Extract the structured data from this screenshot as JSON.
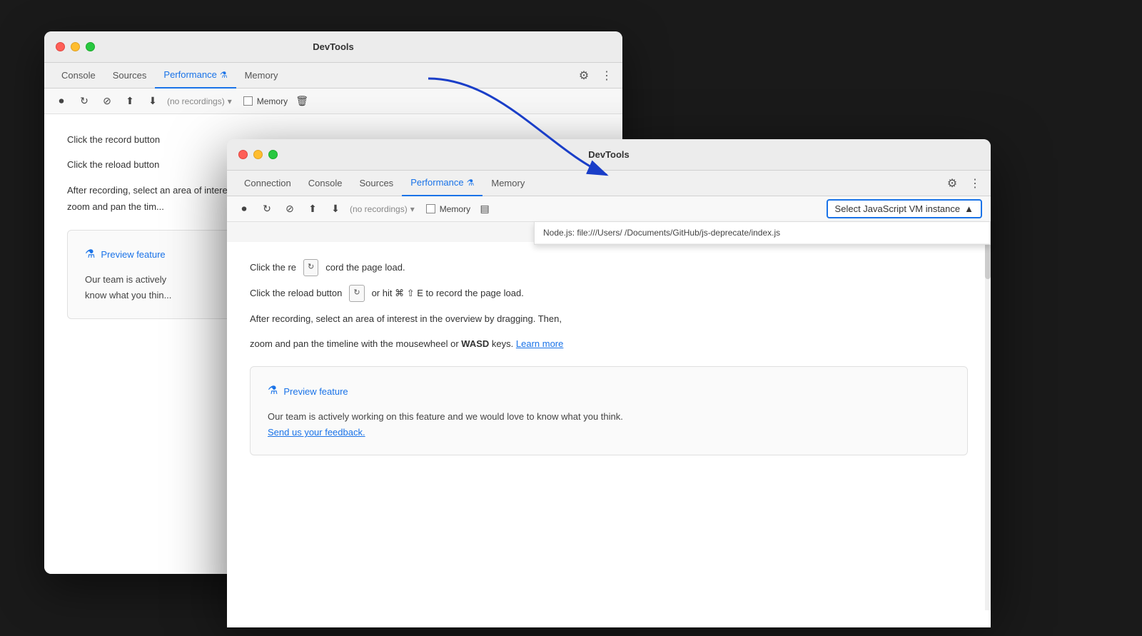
{
  "back_window": {
    "title": "DevTools",
    "tabs": [
      {
        "label": "Console",
        "active": false
      },
      {
        "label": "Sources",
        "active": false
      },
      {
        "label": "Performance",
        "active": true,
        "icon": "⚗"
      },
      {
        "label": "Memory",
        "active": false
      }
    ],
    "toolbar": {
      "recordings_placeholder": "(no recordings)",
      "memory_label": "Memory"
    },
    "content": {
      "line1": "Click the record button",
      "line2": "Click the reload button",
      "line3_part1": "After recording, select an area of interest in the overview by dragging. Then,",
      "line3_part2": "zoom and pan the tim...",
      "preview_title": "Preview feature",
      "preview_text_part1": "Our team is actively",
      "preview_text_part2": "know what you thin..."
    }
  },
  "front_window": {
    "title": "DevTools",
    "tabs": [
      {
        "label": "Connection",
        "active": false
      },
      {
        "label": "Console",
        "active": false
      },
      {
        "label": "Sources",
        "active": false
      },
      {
        "label": "Performance",
        "active": true,
        "icon": "⚗"
      },
      {
        "label": "Memory",
        "active": false
      }
    ],
    "toolbar": {
      "recordings_placeholder": "(no recordings)",
      "memory_label": "Memory"
    },
    "vm_select": {
      "label": "Select JavaScript VM instance",
      "arrow": "▲",
      "options": [
        {
          "label": "Node.js: file:///Users/         /Documents/GitHub/js-deprecate/index.js"
        }
      ]
    },
    "content": {
      "line1_start": "Click the re",
      "line2": "Click the reload button",
      "line2_shortcut": "or hit ⌘ ⇧ E to record the page load.",
      "line3": "After recording, select an area of interest in the overview by dragging. Then,",
      "line4_part1": "zoom and pan the timeline with the mousewheel or",
      "line4_bold": "WASD",
      "line4_part2": "keys.",
      "line4_link": "Learn more",
      "preview_title": "Preview feature",
      "preview_text": "Our team is actively working on this feature and we would love to know what you think.",
      "preview_link": "Send us your feedback."
    }
  },
  "icons": {
    "gear": "⚙",
    "more": "⋮",
    "record": "⏺",
    "reload": "↻",
    "stop": "⊘",
    "upload": "⬆",
    "download": "⬇",
    "delete": "🗑",
    "cpu": "▤",
    "chevron_down": "▾",
    "chevron_up": "▲",
    "flask": "⚗"
  },
  "arrow": {
    "color": "#1a3ec8"
  }
}
